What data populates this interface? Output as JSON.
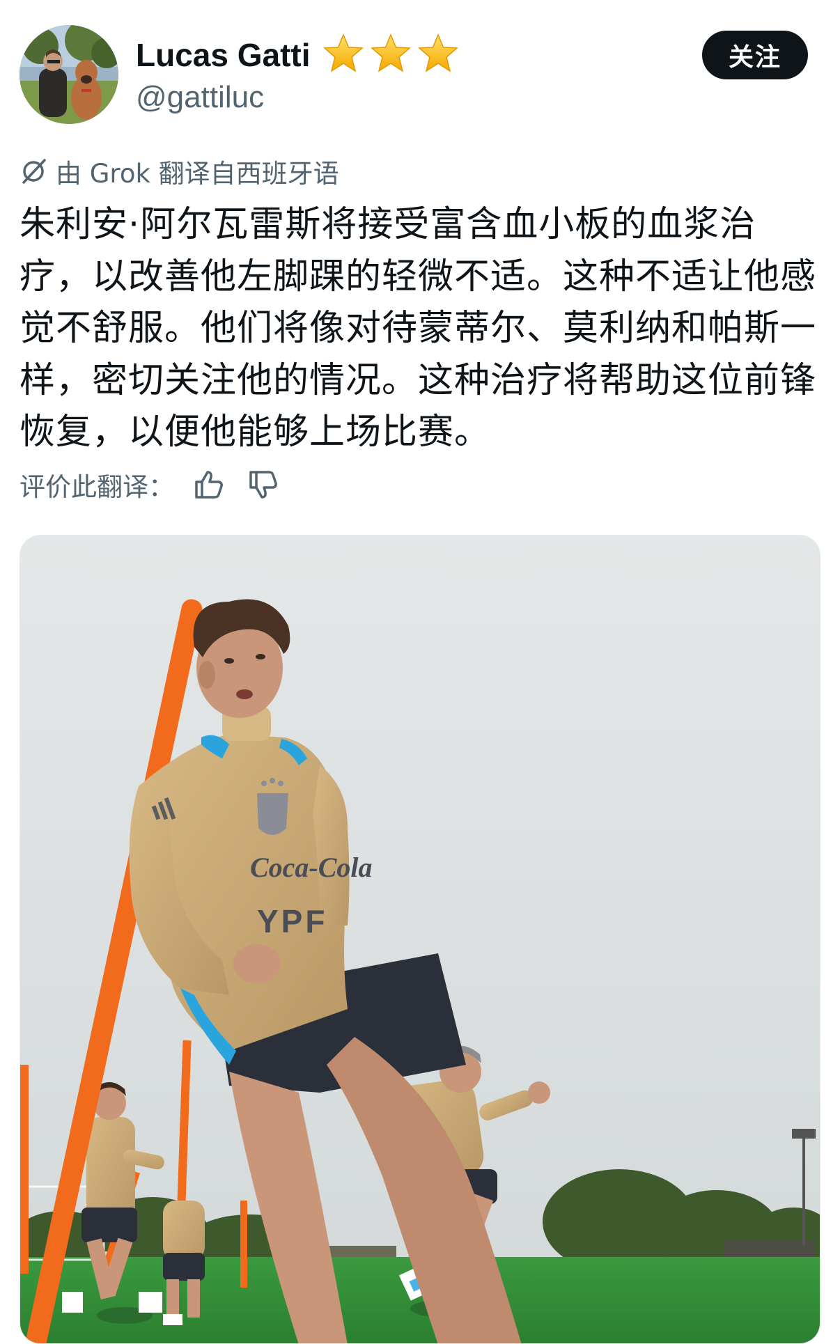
{
  "author": {
    "display_name": "Lucas Gatti",
    "handle": "@gattiluc",
    "badges": [
      "star-icon",
      "star-icon",
      "star-icon"
    ]
  },
  "follow_button": {
    "label": "关注"
  },
  "translation": {
    "label": "由 Grok 翻译自西班牙语",
    "icon": "grok-icon"
  },
  "tweet": {
    "text": "朱利安·阿尔瓦雷斯将接受富含血小板的血浆治疗，以改善他左脚踝的轻微不适。这种不适让他感觉不舒服。他们将像对待蒙蒂尔、莫利纳和帕斯一样，密切关注他的情况。这种治疗将帮助这位前锋恢复，以便他能够上场比赛。"
  },
  "rating": {
    "label": "评价此翻译：",
    "up_icon": "thumbs-up-icon",
    "down_icon": "thumbs-down-icon"
  },
  "media": {
    "jersey_texts": [
      "Coca-Cola",
      "YPF"
    ],
    "colors": {
      "sky": "#dfe3e3",
      "grass": "#2f8a36",
      "jersey": "#c9ab78",
      "pole": "#f26a1b"
    }
  }
}
